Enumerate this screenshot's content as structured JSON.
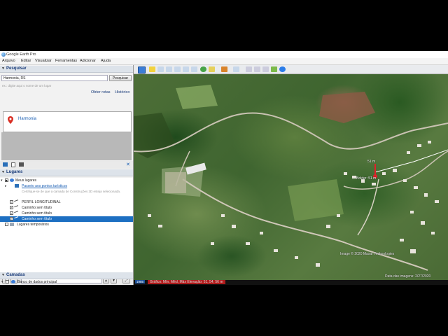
{
  "window": {
    "title": "Google Earth Pro"
  },
  "menu": [
    "Arquivo",
    "Editar",
    "Visualizar",
    "Ferramentas",
    "Adicionar",
    "Ajuda"
  ],
  "search": {
    "header": "Pesquisar",
    "value": "Harmonia, RS",
    "button": "Pesquisar",
    "hint": "ex.: digite aqui o nome de um lugar",
    "route_link": "Obter rotas",
    "history_link": "Histórico",
    "result": "Harmonia"
  },
  "places": {
    "header": "Lugares",
    "items": [
      {
        "label": "Meus lugares",
        "checked": "■",
        "selected": false
      },
      {
        "label": "Passeio aos pontos turísticos",
        "checked": "",
        "selected": false
      },
      {
        "label": "Certifique-se de que a camada de Construções 3D esteja selecionada.",
        "checked": "",
        "selected": false
      },
      {
        "label": "PERFIL LONGITUDINAL",
        "checked": "✓",
        "selected": false
      },
      {
        "label": "Caminho sem título",
        "checked": "✓",
        "selected": false
      },
      {
        "label": "Caminho sem título",
        "checked": "✓",
        "selected": false
      },
      {
        "label": "Caminho sem título",
        "checked": "✓",
        "selected": true
      },
      {
        "label": "Lugares temporários",
        "checked": "",
        "selected": false
      }
    ]
  },
  "layers": {
    "header": "Camadas",
    "primary_db": "Banco de dados principal"
  },
  "map": {
    "marker_elevation": "51 m",
    "marker_label": "Bolder: 51 m",
    "attribution": "Image © 2020 Maxar Technologies",
    "imagery_date": "Data das imagens: 2/27/2020",
    "year_badge": "1985",
    "elevation_profile": "Gráfico: Mín, Méd, Máx Elevação: 51, 54, 56 m"
  },
  "colors": {
    "selection": "#1d6fc2",
    "marker": "#e0202a"
  }
}
